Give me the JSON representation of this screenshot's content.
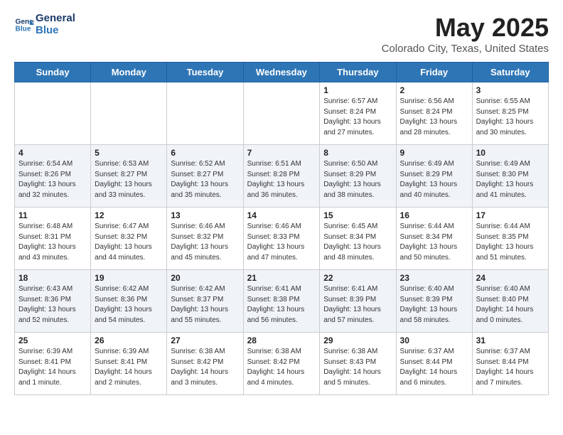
{
  "header": {
    "logo_line1": "General",
    "logo_line2": "Blue",
    "main_title": "May 2025",
    "subtitle": "Colorado City, Texas, United States"
  },
  "days_of_week": [
    "Sunday",
    "Monday",
    "Tuesday",
    "Wednesday",
    "Thursday",
    "Friday",
    "Saturday"
  ],
  "weeks": [
    [
      {
        "day": "",
        "info": ""
      },
      {
        "day": "",
        "info": ""
      },
      {
        "day": "",
        "info": ""
      },
      {
        "day": "",
        "info": ""
      },
      {
        "day": "1",
        "info": "Sunrise: 6:57 AM\nSunset: 8:24 PM\nDaylight: 13 hours\nand 27 minutes."
      },
      {
        "day": "2",
        "info": "Sunrise: 6:56 AM\nSunset: 8:24 PM\nDaylight: 13 hours\nand 28 minutes."
      },
      {
        "day": "3",
        "info": "Sunrise: 6:55 AM\nSunset: 8:25 PM\nDaylight: 13 hours\nand 30 minutes."
      }
    ],
    [
      {
        "day": "4",
        "info": "Sunrise: 6:54 AM\nSunset: 8:26 PM\nDaylight: 13 hours\nand 32 minutes."
      },
      {
        "day": "5",
        "info": "Sunrise: 6:53 AM\nSunset: 8:27 PM\nDaylight: 13 hours\nand 33 minutes."
      },
      {
        "day": "6",
        "info": "Sunrise: 6:52 AM\nSunset: 8:27 PM\nDaylight: 13 hours\nand 35 minutes."
      },
      {
        "day": "7",
        "info": "Sunrise: 6:51 AM\nSunset: 8:28 PM\nDaylight: 13 hours\nand 36 minutes."
      },
      {
        "day": "8",
        "info": "Sunrise: 6:50 AM\nSunset: 8:29 PM\nDaylight: 13 hours\nand 38 minutes."
      },
      {
        "day": "9",
        "info": "Sunrise: 6:49 AM\nSunset: 8:29 PM\nDaylight: 13 hours\nand 40 minutes."
      },
      {
        "day": "10",
        "info": "Sunrise: 6:49 AM\nSunset: 8:30 PM\nDaylight: 13 hours\nand 41 minutes."
      }
    ],
    [
      {
        "day": "11",
        "info": "Sunrise: 6:48 AM\nSunset: 8:31 PM\nDaylight: 13 hours\nand 43 minutes."
      },
      {
        "day": "12",
        "info": "Sunrise: 6:47 AM\nSunset: 8:32 PM\nDaylight: 13 hours\nand 44 minutes."
      },
      {
        "day": "13",
        "info": "Sunrise: 6:46 AM\nSunset: 8:32 PM\nDaylight: 13 hours\nand 45 minutes."
      },
      {
        "day": "14",
        "info": "Sunrise: 6:46 AM\nSunset: 8:33 PM\nDaylight: 13 hours\nand 47 minutes."
      },
      {
        "day": "15",
        "info": "Sunrise: 6:45 AM\nSunset: 8:34 PM\nDaylight: 13 hours\nand 48 minutes."
      },
      {
        "day": "16",
        "info": "Sunrise: 6:44 AM\nSunset: 8:34 PM\nDaylight: 13 hours\nand 50 minutes."
      },
      {
        "day": "17",
        "info": "Sunrise: 6:44 AM\nSunset: 8:35 PM\nDaylight: 13 hours\nand 51 minutes."
      }
    ],
    [
      {
        "day": "18",
        "info": "Sunrise: 6:43 AM\nSunset: 8:36 PM\nDaylight: 13 hours\nand 52 minutes."
      },
      {
        "day": "19",
        "info": "Sunrise: 6:42 AM\nSunset: 8:36 PM\nDaylight: 13 hours\nand 54 minutes."
      },
      {
        "day": "20",
        "info": "Sunrise: 6:42 AM\nSunset: 8:37 PM\nDaylight: 13 hours\nand 55 minutes."
      },
      {
        "day": "21",
        "info": "Sunrise: 6:41 AM\nSunset: 8:38 PM\nDaylight: 13 hours\nand 56 minutes."
      },
      {
        "day": "22",
        "info": "Sunrise: 6:41 AM\nSunset: 8:39 PM\nDaylight: 13 hours\nand 57 minutes."
      },
      {
        "day": "23",
        "info": "Sunrise: 6:40 AM\nSunset: 8:39 PM\nDaylight: 13 hours\nand 58 minutes."
      },
      {
        "day": "24",
        "info": "Sunrise: 6:40 AM\nSunset: 8:40 PM\nDaylight: 14 hours\nand 0 minutes."
      }
    ],
    [
      {
        "day": "25",
        "info": "Sunrise: 6:39 AM\nSunset: 8:41 PM\nDaylight: 14 hours\nand 1 minute."
      },
      {
        "day": "26",
        "info": "Sunrise: 6:39 AM\nSunset: 8:41 PM\nDaylight: 14 hours\nand 2 minutes."
      },
      {
        "day": "27",
        "info": "Sunrise: 6:38 AM\nSunset: 8:42 PM\nDaylight: 14 hours\nand 3 minutes."
      },
      {
        "day": "28",
        "info": "Sunrise: 6:38 AM\nSunset: 8:42 PM\nDaylight: 14 hours\nand 4 minutes."
      },
      {
        "day": "29",
        "info": "Sunrise: 6:38 AM\nSunset: 8:43 PM\nDaylight: 14 hours\nand 5 minutes."
      },
      {
        "day": "30",
        "info": "Sunrise: 6:37 AM\nSunset: 8:44 PM\nDaylight: 14 hours\nand 6 minutes."
      },
      {
        "day": "31",
        "info": "Sunrise: 6:37 AM\nSunset: 8:44 PM\nDaylight: 14 hours\nand 7 minutes."
      }
    ]
  ]
}
